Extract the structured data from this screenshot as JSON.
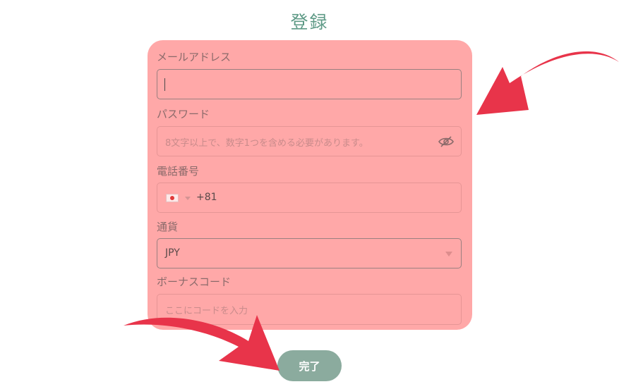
{
  "page": {
    "title": "登録"
  },
  "form": {
    "email": {
      "label": "メールアドレス",
      "value": ""
    },
    "password": {
      "label": "パスワード",
      "placeholder": "8文字以上で、数字1つを含める必要があります。"
    },
    "phone": {
      "label": "電話番号",
      "country_flag": "japan-flag-icon",
      "dial_code": "+81"
    },
    "currency": {
      "label": "通貨",
      "selected": "JPY"
    },
    "bonus_code": {
      "label": "ボーナスコード",
      "placeholder": "ここにコードを入力"
    },
    "submit_label": "完了"
  },
  "colors": {
    "title": "#5e9a86",
    "panel_highlight": "#ffa8a8",
    "submit_button": "#8bab9e",
    "annotation_arrow": "#e8344a"
  }
}
